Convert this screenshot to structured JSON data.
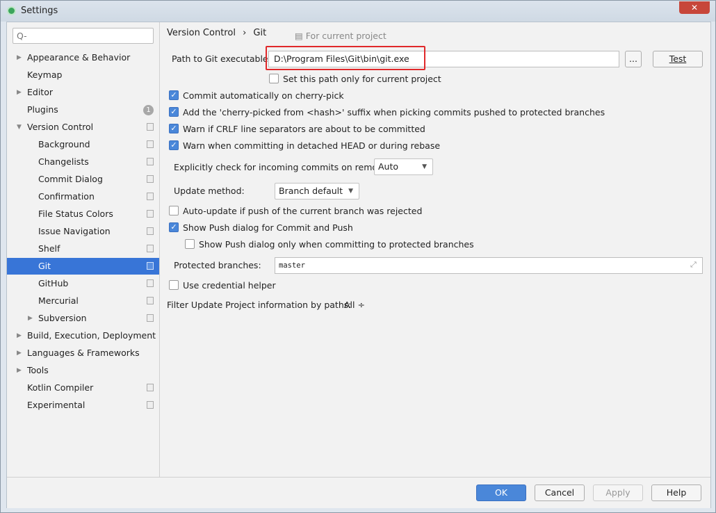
{
  "window": {
    "title": "Settings"
  },
  "sidebar": {
    "search_placeholder": "Q-",
    "items": [
      {
        "label": "Appearance & Behavior",
        "arrow": "▶"
      },
      {
        "label": "Keymap"
      },
      {
        "label": "Editor",
        "arrow": "▶"
      },
      {
        "label": "Plugins",
        "badge": "1"
      },
      {
        "label": "Version Control",
        "arrow": "▼"
      },
      {
        "label": "Background"
      },
      {
        "label": "Changelists"
      },
      {
        "label": "Commit Dialog"
      },
      {
        "label": "Confirmation"
      },
      {
        "label": "File Status Colors"
      },
      {
        "label": "Issue Navigation"
      },
      {
        "label": "Shelf"
      },
      {
        "label": "Git",
        "selected": true
      },
      {
        "label": "GitHub"
      },
      {
        "label": "Mercurial"
      },
      {
        "label": "Subversion",
        "arrow": "▶"
      },
      {
        "label": "Build, Execution, Deployment",
        "arrow": "▶"
      },
      {
        "label": "Languages & Frameworks",
        "arrow": "▶"
      },
      {
        "label": "Tools",
        "arrow": "▶"
      },
      {
        "label": "Kotlin Compiler"
      },
      {
        "label": "Experimental"
      }
    ]
  },
  "main": {
    "breadcrumb": {
      "parent": "Version Control",
      "sep": "›",
      "current": "Git",
      "scope": "For current project"
    },
    "git_path": {
      "label": "Path to Git executable:",
      "value": "D:\\Program Files\\Git\\bin\\git.exe",
      "browse": "...",
      "test": "Test"
    },
    "path_only_project": "Set this path only for current project",
    "cherry_pick": "Commit automatically on cherry-pick",
    "cherry_suffix": "Add the 'cherry-picked from <hash>' suffix when picking commits pushed to protected branches",
    "crlf": "Warn if CRLF line separators are about to be committed",
    "detached": "Warn when committing in detached HEAD or during rebase",
    "incoming": {
      "label": "Explicitly check for incoming commits on remotes:",
      "value": "Auto"
    },
    "update_method": {
      "label": "Update method:",
      "value": "Branch default"
    },
    "auto_update": "Auto-update if push of the current branch was rejected",
    "show_push": "Show Push dialog for Commit and Push",
    "show_push_protected": "Show Push dialog only when committing to protected branches",
    "protected": {
      "label": "Protected branches:",
      "value": "master"
    },
    "credential": "Use credential helper",
    "filter": {
      "label": "Filter Update Project information by paths:",
      "value": "All ÷"
    }
  },
  "footer": {
    "ok": "OK",
    "cancel": "Cancel",
    "apply": "Apply",
    "help": "Help"
  },
  "colors": {
    "accent": "#3875d7",
    "highlight": "#e0282a"
  }
}
